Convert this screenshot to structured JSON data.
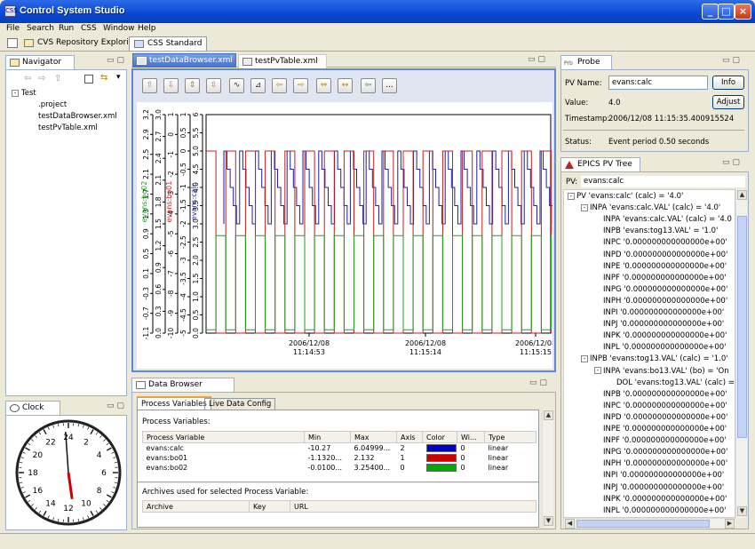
{
  "window": {
    "title": "Control System Studio"
  },
  "menu": [
    "File",
    "Search",
    "Run",
    "CSS",
    "Window",
    "Help"
  ],
  "perspectives": [
    {
      "label": "CVS Repository Exploring"
    },
    {
      "label": "CSS Standard"
    }
  ],
  "navigator": {
    "title": "Navigator",
    "root": "Test",
    "items": [
      ".project",
      "testDataBrowser.xml",
      "testPvTable.xml"
    ]
  },
  "clock": {
    "title": "Clock",
    "numbers": [
      "2",
      "4",
      "6",
      "8",
      "10",
      "12",
      "14",
      "16",
      "18",
      "20",
      "22",
      "24"
    ],
    "hour_hand_angle_deg": 172,
    "minute_hand_angle_deg": -4
  },
  "editor_tabs": [
    {
      "label": "testDataBrowser.xml"
    },
    {
      "label": "testPvTable.xml"
    }
  ],
  "toolbar": {
    "more_label": "..."
  },
  "chart_data": {
    "type": "line",
    "series": [
      {
        "name": "evans:calc",
        "color": "#1f1fa0",
        "ylim": [
          0.0,
          6.0
        ],
        "ticks": [
          "0.0",
          "0.5",
          "1.0",
          "1.5",
          "2.0",
          "2.5",
          "3.0",
          "3.5",
          "4.0",
          "4.5",
          "5.0",
          "5.5",
          "6"
        ]
      },
      {
        "name": "evans:bo01",
        "color": "#c02020",
        "ylim": [
          -5.0,
          1.0
        ],
        "ticks": [
          "-5",
          "-4.5",
          "-4",
          "-3.5",
          "-3",
          "-2.5",
          "-2",
          "-1.5",
          "-1",
          "-0.5",
          "0",
          "0.5",
          "1"
        ]
      },
      {
        "name": "evans:bo02",
        "color": "#1fa01f",
        "ylim": [
          -11,
          2
        ],
        "ticks": [
          "-10",
          "-9",
          "-8",
          "-7",
          "-6",
          "-5",
          "-4",
          "-3",
          "-2",
          "-1",
          "0",
          "1"
        ]
      },
      {
        "name": "",
        "color": "#000000",
        "ylim": [
          -0.1,
          3.1
        ],
        "ticks": [
          "0.0",
          "0.3",
          "0.6",
          "0.9",
          "1.2",
          "1.5",
          "1.8",
          "2.1",
          "2.4",
          "2.7",
          "3.0"
        ]
      },
      {
        "name": "",
        "color": "#000000",
        "ylim": [
          -1.1,
          3.2
        ],
        "ticks": [
          "-1.1",
          "-0.7",
          "-0.3",
          "0.1",
          "0.5",
          "0.9",
          "1.3",
          "1.7",
          "2.1",
          "2.5",
          "2.9",
          "3.2"
        ]
      }
    ],
    "x_ticks": [
      {
        "date": "2006/12/08",
        "time": "11:14:53"
      },
      {
        "date": "2006/12/08",
        "time": "11:15:14"
      },
      {
        "date": "2006/12/08",
        "time": "11:15:15"
      }
    ]
  },
  "config": {
    "title": "Data Browser Config",
    "tabs": [
      "Process Variables",
      "Live Data Config"
    ],
    "pv_section": "Process Variables:",
    "columns": [
      "Process Variable",
      "Min",
      "Max",
      "Axis",
      "Color",
      "Wi...",
      "Type"
    ],
    "rows": [
      {
        "pv": "evans:calc",
        "min": "-10.27",
        "max": "6.04999...",
        "axis": "2",
        "color": "#0000cc",
        "width": "0",
        "type": "linear"
      },
      {
        "pv": "evans:bo01",
        "min": "-1.1320...",
        "max": "2.132",
        "axis": "1",
        "color": "#cc0000",
        "width": "0",
        "type": "linear"
      },
      {
        "pv": "evans:bo02",
        "min": "-0.0100...",
        "max": "3.25400...",
        "axis": "0",
        "color": "#00aa00",
        "width": "0",
        "type": "linear"
      }
    ],
    "archives_section": "Archives used for selected Process Variable:",
    "archive_columns": [
      "Archive",
      "Key",
      "URL"
    ]
  },
  "probe": {
    "title": "Probe",
    "pv_name_label": "PV Name:",
    "pv_name": "evans:calc",
    "info_label": "Info",
    "value_label": "Value:",
    "value": "4.0",
    "adjust_label": "Adjust",
    "timestamp_label": "Timestamp:",
    "timestamp": "2006/12/08 11:15:35.400915524",
    "status_label": "Status:",
    "status": "Event period 0.50 seconds"
  },
  "pvtree": {
    "title": "EPICS PV Tree",
    "pv_label": "PV:",
    "pv": "evans:calc",
    "nodes": [
      {
        "indent": 0,
        "exp": "-",
        "text": "PV 'evans:calc' (calc) = '4.0'"
      },
      {
        "indent": 1,
        "exp": "-",
        "text": "INPA 'evans:calc.VAL' (calc) = '4.0'"
      },
      {
        "indent": 2,
        "exp": "",
        "text": "INPA 'evans:calc.VAL' (calc) = '4.0"
      },
      {
        "indent": 2,
        "exp": "",
        "text": "INPB 'evans:tog13.VAL' = '1.0'"
      },
      {
        "indent": 2,
        "exp": "",
        "text": "INPC '0.000000000000000e+00'"
      },
      {
        "indent": 2,
        "exp": "",
        "text": "INPD '0.000000000000000e+00'"
      },
      {
        "indent": 2,
        "exp": "",
        "text": "INPE '0.000000000000000e+00'"
      },
      {
        "indent": 2,
        "exp": "",
        "text": "INPF '0.000000000000000e+00'"
      },
      {
        "indent": 2,
        "exp": "",
        "text": "INPG '0.000000000000000e+00'"
      },
      {
        "indent": 2,
        "exp": "",
        "text": "INPH '0.000000000000000e+00'"
      },
      {
        "indent": 2,
        "exp": "",
        "text": "INPI '0.000000000000000e+00'"
      },
      {
        "indent": 2,
        "exp": "",
        "text": "INPJ '0.000000000000000e+00'"
      },
      {
        "indent": 2,
        "exp": "",
        "text": "INPK '0.000000000000000e+00'"
      },
      {
        "indent": 2,
        "exp": "",
        "text": "INPL '0.000000000000000e+00'"
      },
      {
        "indent": 1,
        "exp": "-",
        "text": "INPB 'evans:tog13.VAL' (calc) = '1.0'"
      },
      {
        "indent": 2,
        "exp": "-",
        "text": "INPA 'evans:bo13.VAL' (bo) = 'On"
      },
      {
        "indent": 3,
        "exp": "",
        "text": "DOL 'evans:tog13.VAL' (calc) ="
      },
      {
        "indent": 2,
        "exp": "",
        "text": "INPB '0.000000000000000e+00'"
      },
      {
        "indent": 2,
        "exp": "",
        "text": "INPC '0.000000000000000e+00'"
      },
      {
        "indent": 2,
        "exp": "",
        "text": "INPD '0.000000000000000e+00'"
      },
      {
        "indent": 2,
        "exp": "",
        "text": "INPE '0.000000000000000e+00'"
      },
      {
        "indent": 2,
        "exp": "",
        "text": "INPF '0.000000000000000e+00'"
      },
      {
        "indent": 2,
        "exp": "",
        "text": "INPG '0.000000000000000e+00'"
      },
      {
        "indent": 2,
        "exp": "",
        "text": "INPH '0.000000000000000e+00'"
      },
      {
        "indent": 2,
        "exp": "",
        "text": "INPI '0.000000000000000e+00'"
      },
      {
        "indent": 2,
        "exp": "",
        "text": "INPJ '0.000000000000000e+00'"
      },
      {
        "indent": 2,
        "exp": "",
        "text": "INPK '0.000000000000000e+00'"
      },
      {
        "indent": 2,
        "exp": "",
        "text": "INPL '0.000000000000000e+00'"
      }
    ]
  }
}
